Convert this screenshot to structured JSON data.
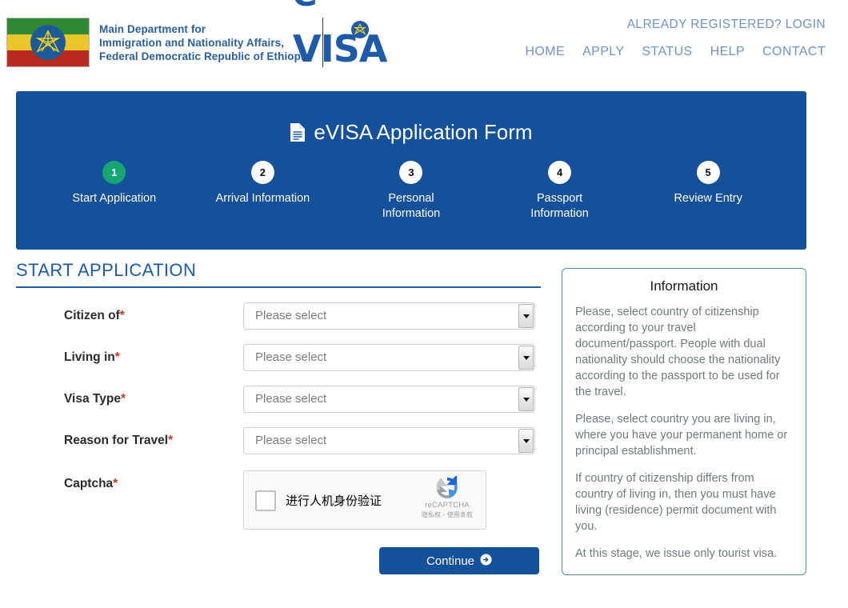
{
  "header": {
    "brand_lines": [
      "Main Department for",
      "Immigration and Nationality Affairs,",
      "Federal Democratic Republic of Ethiopia"
    ],
    "logo_text": "e-VISA",
    "login_link": "ALREADY REGISTERED? LOGIN",
    "nav": [
      {
        "label": "HOME"
      },
      {
        "label": "APPLY"
      },
      {
        "label": "STATUS"
      },
      {
        "label": "HELP"
      },
      {
        "label": "CONTACT"
      }
    ],
    "colors": {
      "brand_blue": "#2a5fa0",
      "nav_blue": "#6f93c4",
      "logo_blue": "#1f5aa8"
    }
  },
  "banner": {
    "title": "eVISA Application Form",
    "icon": "document-icon",
    "background": "#15519a",
    "active_color": "#17a673",
    "steps": [
      {
        "number": "1",
        "label": "Start Application",
        "active": true
      },
      {
        "number": "2",
        "label": "Arrival Information",
        "active": false
      },
      {
        "number": "3",
        "label": "Personal Information",
        "active": false
      },
      {
        "number": "4",
        "label": "Passport Information",
        "active": false
      },
      {
        "number": "5",
        "label": "Review Entry",
        "active": false
      }
    ]
  },
  "form": {
    "section_title": "START APPLICATION",
    "required_mark": "*",
    "fields": [
      {
        "label": "Citizen of",
        "value": "Please select",
        "name": "citizen-of"
      },
      {
        "label": "Living in",
        "value": "Please select",
        "name": "living-in"
      },
      {
        "label": "Visa Type",
        "value": "Please select",
        "name": "visa-type"
      },
      {
        "label": "Reason for Travel",
        "value": "Please select",
        "name": "reason-for-travel"
      }
    ],
    "captcha": {
      "label": "Captcha",
      "checkbox_text": "进行人机身份验证",
      "brand": "reCAPTCHA",
      "terms": "隐私权 - 使用条款"
    },
    "continue_label": "Continue"
  },
  "info": {
    "title": "Information",
    "paragraphs": [
      "Please, select country of citizenship according to your travel document/passport. People with dual nationality should choose the nationality according to the passport to be used for the travel.",
      "Please, select country you are living in, where you have your permanent home or principal establishment.",
      "If country of citizenship differs from country of living in, then you must have living (residence) permit document with you.",
      "At this stage, we issue only tourist visa."
    ]
  }
}
